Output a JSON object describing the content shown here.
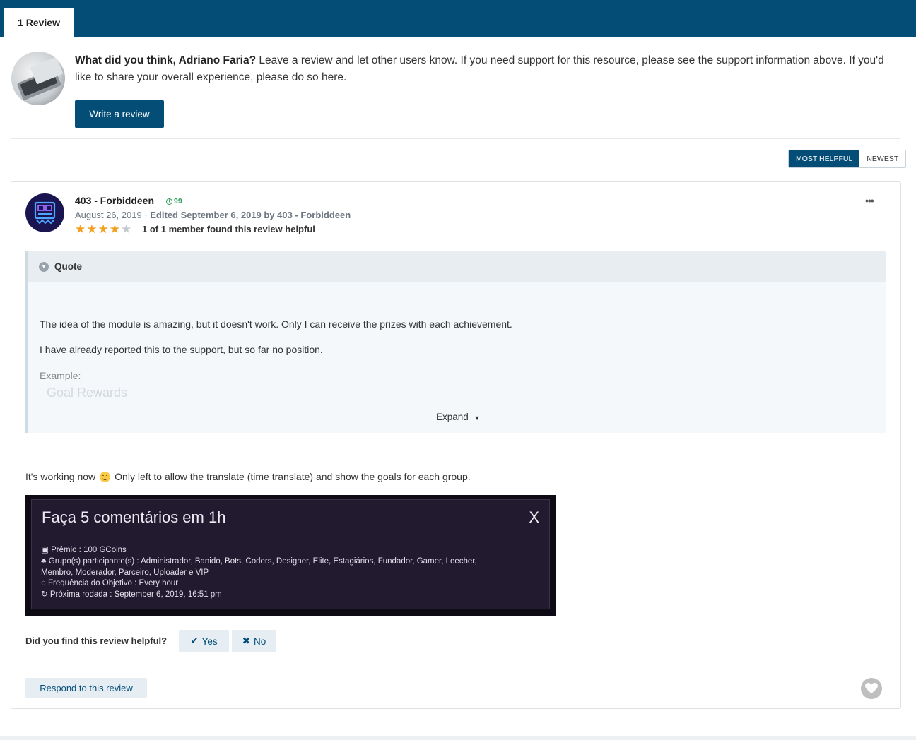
{
  "tabs": {
    "active_label": "1 Review"
  },
  "prompt": {
    "question": "What did you think, Adriano Faria?",
    "message": " Leave a review and let other users know. If you need support for this resource, please see the support information above. If you'd like to share your overall experience, please do so here.",
    "button_label": "Write a review"
  },
  "sort": {
    "options": [
      "MOST HELPFUL",
      "NEWEST"
    ],
    "selected": "MOST HELPFUL"
  },
  "review": {
    "author": "403 - Forbiddeen",
    "reputation": "99",
    "date": "August 26, 2019",
    "separator": " · ",
    "edited": "Edited September 6, 2019 by 403 - Forbiddeen",
    "rating": 4,
    "rating_max": 5,
    "helpful_count_text": "1 of 1 member found this review helpful",
    "quote": {
      "header": "Quote",
      "paragraphs": [
        "The idea of the module is amazing, but it doesn't work. Only I can receive the prizes with each achievement.",
        "I have already reported this to the support, but so far no position.",
        "Example:"
      ],
      "faded_text": "Goal Rewards",
      "expand_label": "Expand"
    },
    "body_before_emoji": "It's working now",
    "body_after_emoji": "Only left to allow the translate (time translate) and show the goals for each group.",
    "embedded_image": {
      "title": "Faça 5 comentários em 1h",
      "close": "X",
      "lines": [
        "Prêmio : 100 GCoins",
        "Grupo(s) participante(s) : Administrador, Banido, Bots, Coders, Designer, Elite, Estagiários, Fundador, Gamer, Leecher,",
        "Membro, Moderador, Parceiro, Uploader e VIP",
        "Frequência do Objetivo : Every hour",
        "Próxima rodada : September 6, 2019, 16:51 pm"
      ]
    },
    "helpful_question": "Did you find this review helpful?",
    "yes_label": "Yes",
    "no_label": "No",
    "respond_label": "Respond to this review"
  }
}
